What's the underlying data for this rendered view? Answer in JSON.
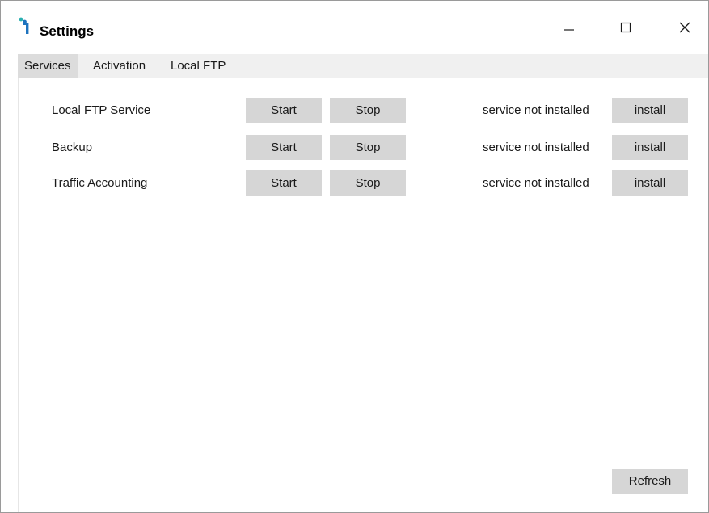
{
  "window": {
    "title": "Settings"
  },
  "title_bar": {
    "minimize_icon": "minimize-icon",
    "maximize_icon": "maximize-icon",
    "close_icon": "close-icon"
  },
  "tabs": [
    {
      "label": "Services",
      "active": true
    },
    {
      "label": "Activation",
      "active": false
    },
    {
      "label": "Local FTP",
      "active": false
    }
  ],
  "services": [
    {
      "name": "Local FTP Service",
      "start_label": "Start",
      "stop_label": "Stop",
      "status": "service not installed",
      "install_label": "install"
    },
    {
      "name": "Backup",
      "start_label": "Start",
      "stop_label": "Stop",
      "status": "service not installed",
      "install_label": "install"
    },
    {
      "name": "Traffic Accounting",
      "start_label": "Start",
      "stop_label": "Stop",
      "status": "service not installed",
      "install_label": "install"
    }
  ],
  "footer": {
    "refresh_label": "Refresh"
  },
  "colors": {
    "button_bg": "#d6d6d6",
    "tabstrip_bg": "#f0f0f0",
    "active_tab_bg": "#dcdcdc",
    "icon_blue": "#1e73be",
    "icon_teal": "#29b0b0"
  }
}
